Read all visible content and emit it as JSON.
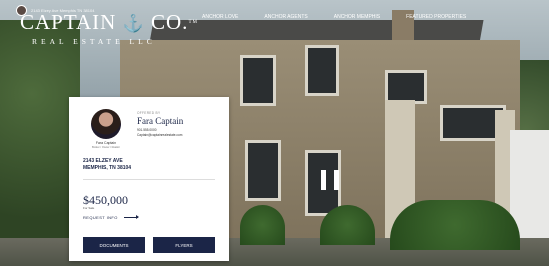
{
  "topline": {
    "text": "2143 Elzey Ave Memphis TN 38104"
  },
  "brand": {
    "name": "CAPTAIN",
    "anchor_glyph": "⚓",
    "name2": "CO.",
    "tm": "TM",
    "subtitle": "REAL ESTATE LLC"
  },
  "nav": {
    "items": [
      "ANCHOR LOVE",
      "ANCHOR AGENTS",
      "ANCHOR MEMPHIS",
      "FEATURED PROPERTIES"
    ]
  },
  "card": {
    "offered_by": "OFFERED BY",
    "agent_name": "Fara Captain",
    "agent_name_small": "Fara Captain",
    "agent_meta": "Broker / Owner / Realtor",
    "agent_phone": "901.555.0000",
    "agent_email": "Captain@captainrealestate.com",
    "address_line1": "2143 ELZEY AVE",
    "address_line2": "MEMPHIS, TN 38104",
    "price": "$450,000",
    "for_sale": "For Sale",
    "request_info": "REQUEST INFO",
    "documents_label": "DOCUMENTS",
    "flyers_label": "FLYERS"
  },
  "colors": {
    "navy": "#1b2547",
    "white": "#ffffff"
  }
}
